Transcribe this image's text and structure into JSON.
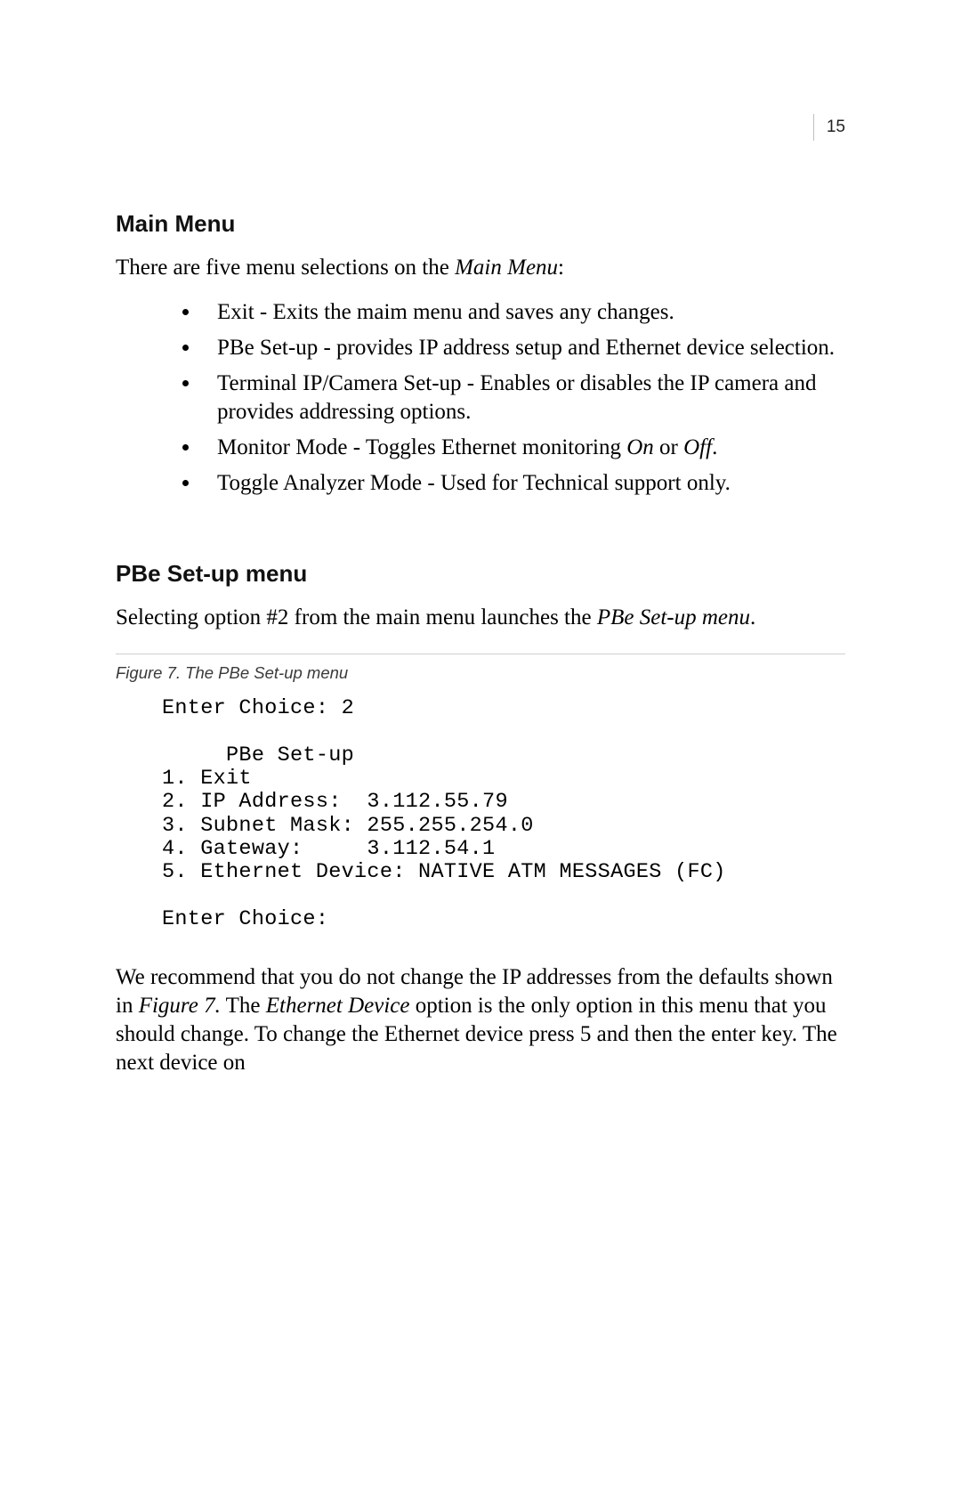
{
  "page_number": "15",
  "section1": {
    "heading": "Main Menu",
    "intro_pre": "There are five menu selections on the ",
    "intro_em": "Main Menu",
    "intro_post": ":",
    "items": [
      "Exit - Exits the maim menu and saves any changes.",
      "PBe Set-up - provides IP address setup and Ethernet device selection.",
      "Terminal IP/Camera Set-up - Enables or disables the IP camera and provides addressing options.",
      {
        "pre": "Monitor Mode - Toggles Ethernet monitoring ",
        "em1": "On",
        "mid": " or ",
        "em2": "Off",
        "post": "."
      },
      "Toggle Analyzer Mode - Used for Technical support only."
    ]
  },
  "section2": {
    "heading": "PBe Set-up menu",
    "intro_pre": "Selecting option #2 from the main menu launches the ",
    "intro_em": "PBe Set-up menu",
    "intro_post": "."
  },
  "figure": {
    "caption": "Figure 7.   The PBe Set-up menu",
    "terminal": "Enter Choice: 2\n\n     PBe Set-up\n1. Exit\n2. IP Address:  3.112.55.79\n3. Subnet Mask: 255.255.254.0\n4. Gateway:     3.112.54.1\n5. Ethernet Device: NATIVE ATM MESSAGES (FC)\n\nEnter Choice:"
  },
  "closing": {
    "p1a": "We recommend that you do not change the IP addresses from the defaults shown in ",
    "p1em1": "Figure 7.",
    "p1b": " The ",
    "p1em2": "Ethernet Device",
    "p1c": " option is the only option in this menu that you should change. To change the Ethernet device press 5 and then the enter key. The next device on"
  }
}
